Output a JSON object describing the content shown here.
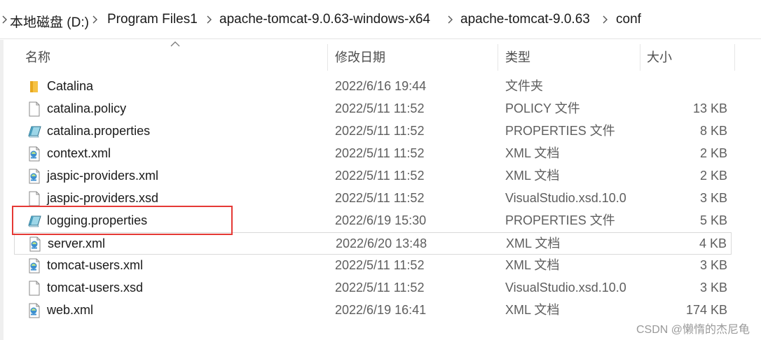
{
  "breadcrumb": [
    {
      "label": "本地磁盘 (D:)"
    },
    {
      "label": "Program Files1"
    },
    {
      "label": "apache-tomcat-9.0.63-windows-x64"
    },
    {
      "label": "apache-tomcat-9.0.63"
    },
    {
      "label": "conf"
    }
  ],
  "columns": {
    "name": "名称",
    "modified": "修改日期",
    "type": "类型",
    "size": "大小"
  },
  "files": [
    {
      "name": "Catalina",
      "modified": "2022/6/16 19:44",
      "type": "文件夹",
      "size": "",
      "icon": "folder-icon"
    },
    {
      "name": "catalina.policy",
      "modified": "2022/5/11 11:52",
      "type": "POLICY 文件",
      "size": "13 KB",
      "icon": "blank-file-icon"
    },
    {
      "name": "catalina.properties",
      "modified": "2022/5/11 11:52",
      "type": "PROPERTIES 文件",
      "size": "8 KB",
      "icon": "properties-file-icon"
    },
    {
      "name": "context.xml",
      "modified": "2022/5/11 11:52",
      "type": "XML 文档",
      "size": "2 KB",
      "icon": "xml-file-icon"
    },
    {
      "name": "jaspic-providers.xml",
      "modified": "2022/5/11 11:52",
      "type": "XML 文档",
      "size": "2 KB",
      "icon": "xml-file-icon"
    },
    {
      "name": "jaspic-providers.xsd",
      "modified": "2022/5/11 11:52",
      "type": "VisualStudio.xsd.10.0",
      "size": "3 KB",
      "icon": "blank-file-icon"
    },
    {
      "name": "logging.properties",
      "modified": "2022/6/19 15:30",
      "type": "PROPERTIES 文件",
      "size": "5 KB",
      "icon": "properties-file-icon"
    },
    {
      "name": "server.xml",
      "modified": "2022/6/20 13:48",
      "type": "XML 文档",
      "size": "4 KB",
      "icon": "xml-file-icon"
    },
    {
      "name": "tomcat-users.xml",
      "modified": "2022/5/11 11:52",
      "type": "XML 文档",
      "size": "3 KB",
      "icon": "xml-file-icon"
    },
    {
      "name": "tomcat-users.xsd",
      "modified": "2022/5/11 11:52",
      "type": "VisualStudio.xsd.10.0",
      "size": "3 KB",
      "icon": "blank-file-icon"
    },
    {
      "name": "web.xml",
      "modified": "2022/6/19 16:41",
      "type": "XML 文档",
      "size": "174 KB",
      "icon": "xml-file-icon"
    }
  ],
  "highlighted_file": "logging.properties",
  "hovered_file": "server.xml",
  "colors": {
    "highlight_box": "#e53935",
    "hover_border": "#d9d9d9",
    "folder": "#f6c244"
  },
  "watermark": "CSDN @懒惰的杰尼龟"
}
